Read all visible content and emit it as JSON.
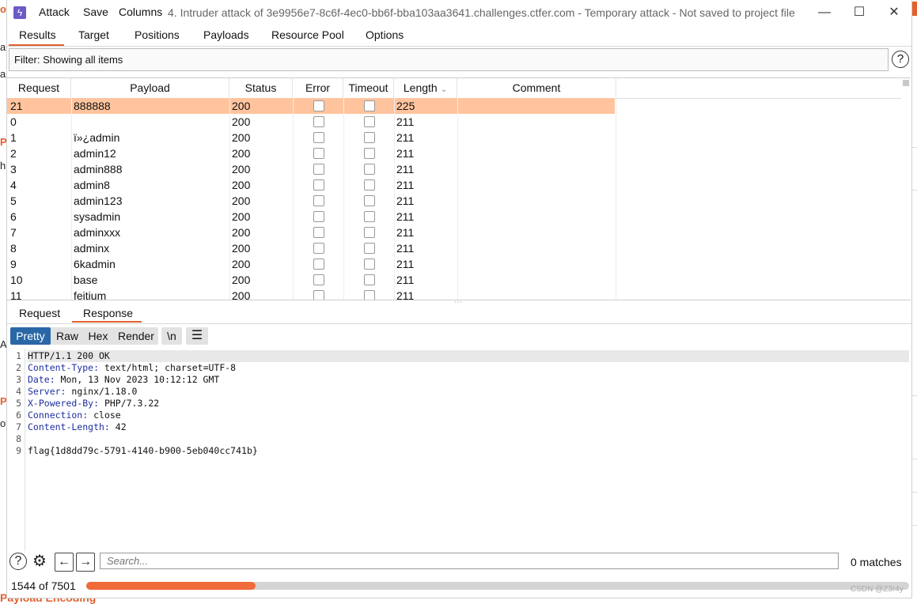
{
  "window": {
    "menu": [
      "Attack",
      "Save",
      "Columns"
    ],
    "title": "4. Intruder attack of 3e9956e7-8c6f-4ec0-bb6f-bba103aa3641.challenges.ctfer.com - Temporary attack - Not saved to project file",
    "controls": {
      "minimize": "—",
      "maximize": "☐",
      "close": "✕"
    }
  },
  "tabs": [
    "Results",
    "Target",
    "Positions",
    "Payloads",
    "Resource Pool",
    "Options"
  ],
  "filter": {
    "label": "Filter: Showing all items",
    "help": "?"
  },
  "table": {
    "columns": [
      "Request",
      "Payload",
      "Status",
      "Error",
      "Timeout",
      "Length",
      "Comment"
    ],
    "rows": [
      {
        "request": "21",
        "payload": "888888",
        "status": "200",
        "length": "225",
        "selected": true
      },
      {
        "request": "0",
        "payload": "",
        "status": "200",
        "length": "211"
      },
      {
        "request": "1",
        "payload": "ï»¿admin",
        "status": "200",
        "length": "211"
      },
      {
        "request": "2",
        "payload": "admin12",
        "status": "200",
        "length": "211"
      },
      {
        "request": "3",
        "payload": "admin888",
        "status": "200",
        "length": "211"
      },
      {
        "request": "4",
        "payload": "admin8",
        "status": "200",
        "length": "211"
      },
      {
        "request": "5",
        "payload": "admin123",
        "status": "200",
        "length": "211"
      },
      {
        "request": "6",
        "payload": "sysadmin",
        "status": "200",
        "length": "211"
      },
      {
        "request": "7",
        "payload": "adminxxx",
        "status": "200",
        "length": "211"
      },
      {
        "request": "8",
        "payload": "adminx",
        "status": "200",
        "length": "211"
      },
      {
        "request": "9",
        "payload": "6kadmin",
        "status": "200",
        "length": "211"
      },
      {
        "request": "10",
        "payload": "base",
        "status": "200",
        "length": "211"
      },
      {
        "request": "11",
        "payload": "feitium",
        "status": "200",
        "length": "211"
      }
    ]
  },
  "detail_tabs": [
    "Request",
    "Response"
  ],
  "view_buttons": [
    "Pretty",
    "Raw",
    "Hex",
    "Render"
  ],
  "newline_button": "\\n",
  "menu_button": "☰",
  "response_lines": [
    {
      "n": "1",
      "key": "",
      "rest": "HTTP/1.1 200 OK"
    },
    {
      "n": "2",
      "key": "Content-Type:",
      "rest": " text/html; charset=UTF-8"
    },
    {
      "n": "3",
      "key": "Date:",
      "rest": " Mon, 13 Nov 2023 10:12:12 GMT"
    },
    {
      "n": "4",
      "key": "Server:",
      "rest": " nginx/1.18.0"
    },
    {
      "n": "5",
      "key": "X-Powered-By:",
      "rest": " PHP/7.3.22"
    },
    {
      "n": "6",
      "key": "Connection:",
      "rest": " close"
    },
    {
      "n": "7",
      "key": "Content-Length:",
      "rest": " 42"
    },
    {
      "n": "8",
      "key": "",
      "rest": ""
    },
    {
      "n": "9",
      "key": "",
      "rest": "flag{1d8dd79c-5791-4140-b900-5eb040cc741b}"
    }
  ],
  "search": {
    "placeholder": "Search...",
    "matches": "0 matches"
  },
  "status": {
    "progress_text": "1544 of 7501",
    "progress_done": 1544,
    "progress_total": 7501
  },
  "watermark": "CSDN @Z3r4y",
  "background": {
    "fragments": [
      "o",
      "a",
      "a",
      "Pa",
      "h",
      "A",
      "Pa",
      "o"
    ],
    "footer_title": "Payload Encoding"
  }
}
